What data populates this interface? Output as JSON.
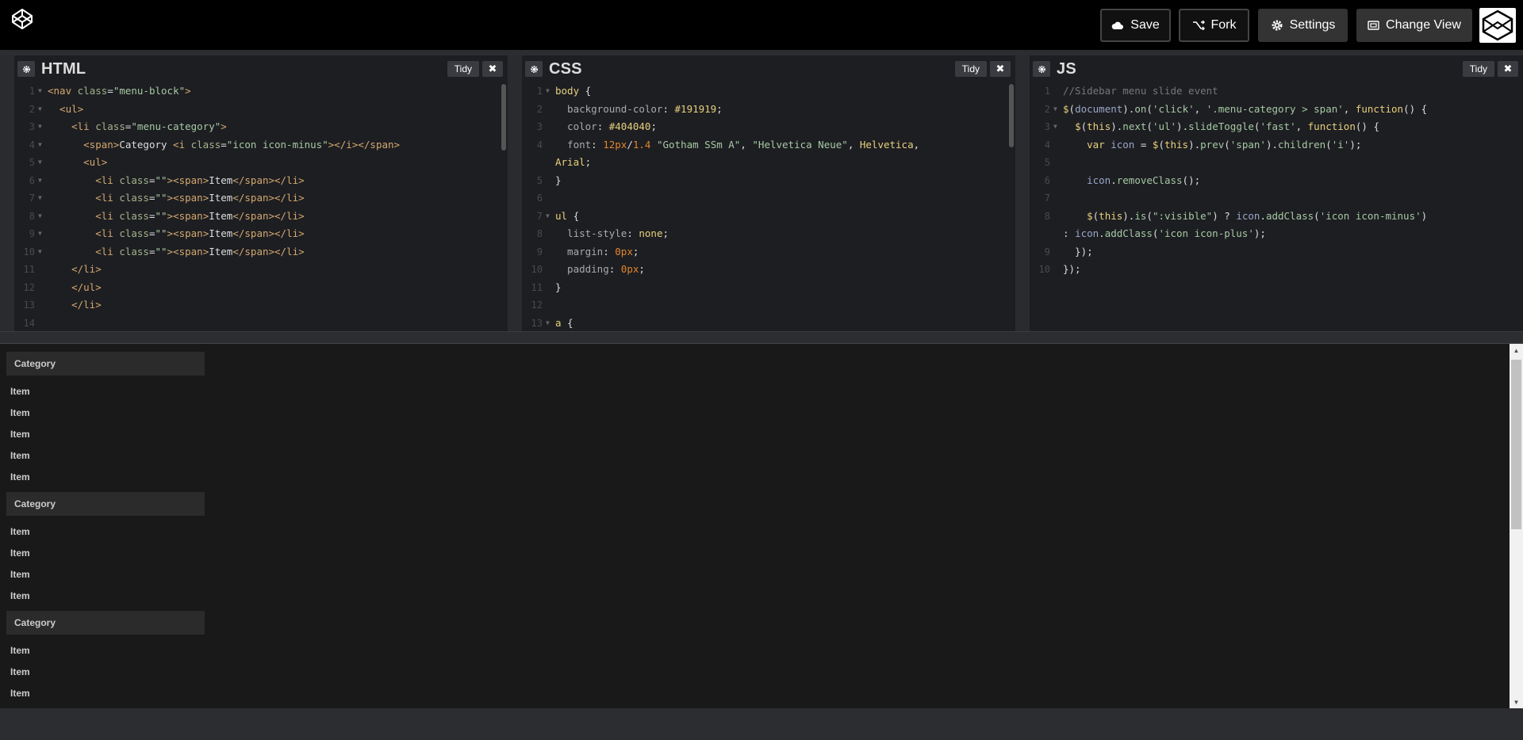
{
  "header": {
    "save_label": "Save",
    "fork_label": "Fork",
    "settings_label": "Settings",
    "change_view_label": "Change View"
  },
  "panes": {
    "html": {
      "title": "HTML",
      "tidy": "Tidy",
      "close": "✖"
    },
    "css": {
      "title": "CSS",
      "tidy": "Tidy",
      "close": "✖"
    },
    "js": {
      "title": "JS",
      "tidy": "Tidy",
      "close": "✖"
    }
  },
  "html_code": [
    {
      "n": "1",
      "f": true,
      "parts": [
        [
          "c-tag",
          "<nav "
        ],
        [
          "c-attr",
          "class"
        ],
        [
          "c-plain",
          "="
        ],
        [
          "c-str",
          "\"menu-block\""
        ],
        [
          "c-tag",
          ">"
        ]
      ]
    },
    {
      "n": "2",
      "f": true,
      "parts": [
        [
          "c-tag",
          "  <ul>"
        ]
      ]
    },
    {
      "n": "3",
      "f": true,
      "parts": [
        [
          "c-tag",
          "    <li "
        ],
        [
          "c-attr",
          "class"
        ],
        [
          "c-plain",
          "="
        ],
        [
          "c-str",
          "\"menu-category\""
        ],
        [
          "c-tag",
          ">"
        ]
      ]
    },
    {
      "n": "4",
      "f": true,
      "parts": [
        [
          "c-tag",
          "      <span>"
        ],
        [
          "c-plain",
          "Category "
        ],
        [
          "c-tag",
          "<i "
        ],
        [
          "c-attr",
          "class"
        ],
        [
          "c-plain",
          "="
        ],
        [
          "c-str",
          "\"icon icon-minus\""
        ],
        [
          "c-tag",
          "></i></span>"
        ]
      ]
    },
    {
      "n": "5",
      "f": true,
      "parts": [
        [
          "c-tag",
          "      <ul>"
        ]
      ]
    },
    {
      "n": "6",
      "f": true,
      "parts": [
        [
          "c-tag",
          "        <li "
        ],
        [
          "c-attr",
          "class"
        ],
        [
          "c-plain",
          "="
        ],
        [
          "c-str",
          "\"\""
        ],
        [
          "c-tag",
          "><span>"
        ],
        [
          "c-plain",
          "Item"
        ],
        [
          "c-tag",
          "</span></li>"
        ]
      ]
    },
    {
      "n": "7",
      "f": true,
      "parts": [
        [
          "c-tag",
          "        <li "
        ],
        [
          "c-attr",
          "class"
        ],
        [
          "c-plain",
          "="
        ],
        [
          "c-str",
          "\"\""
        ],
        [
          "c-tag",
          "><span>"
        ],
        [
          "c-plain",
          "Item"
        ],
        [
          "c-tag",
          "</span></li>"
        ]
      ]
    },
    {
      "n": "8",
      "f": true,
      "parts": [
        [
          "c-tag",
          "        <li "
        ],
        [
          "c-attr",
          "class"
        ],
        [
          "c-plain",
          "="
        ],
        [
          "c-str",
          "\"\""
        ],
        [
          "c-tag",
          "><span>"
        ],
        [
          "c-plain",
          "Item"
        ],
        [
          "c-tag",
          "</span></li>"
        ]
      ]
    },
    {
      "n": "9",
      "f": true,
      "parts": [
        [
          "c-tag",
          "        <li "
        ],
        [
          "c-attr",
          "class"
        ],
        [
          "c-plain",
          "="
        ],
        [
          "c-str",
          "\"\""
        ],
        [
          "c-tag",
          "><span>"
        ],
        [
          "c-plain",
          "Item"
        ],
        [
          "c-tag",
          "</span></li>"
        ]
      ]
    },
    {
      "n": "10",
      "f": true,
      "parts": [
        [
          "c-tag",
          "        <li "
        ],
        [
          "c-attr",
          "class"
        ],
        [
          "c-plain",
          "="
        ],
        [
          "c-str",
          "\"\""
        ],
        [
          "c-tag",
          "><span>"
        ],
        [
          "c-plain",
          "Item"
        ],
        [
          "c-tag",
          "</span></li>"
        ]
      ]
    },
    {
      "n": "11",
      "f": false,
      "parts": [
        [
          "c-tag",
          "    </li>"
        ]
      ]
    },
    {
      "n": "12",
      "f": false,
      "parts": [
        [
          "c-tag",
          "    </ul>"
        ]
      ]
    },
    {
      "n": "13",
      "f": false,
      "parts": [
        [
          "c-tag",
          "    </li>"
        ]
      ]
    },
    {
      "n": "14",
      "f": false,
      "parts": [
        [
          "c-plain",
          ""
        ]
      ]
    }
  ],
  "css_code": [
    {
      "n": "1",
      "f": true,
      "parts": [
        [
          "c-sel",
          "body"
        ],
        [
          "c-plain",
          " {"
        ]
      ]
    },
    {
      "n": "2",
      "f": false,
      "parts": [
        [
          "c-prop",
          "  background-color"
        ],
        [
          "c-plain",
          ": "
        ],
        [
          "c-sel",
          "#191919"
        ],
        [
          "c-plain",
          ";"
        ]
      ]
    },
    {
      "n": "3",
      "f": false,
      "parts": [
        [
          "c-prop",
          "  color"
        ],
        [
          "c-plain",
          ": "
        ],
        [
          "c-sel",
          "#404040"
        ],
        [
          "c-plain",
          ";"
        ]
      ]
    },
    {
      "n": "4",
      "f": false,
      "parts": [
        [
          "c-prop",
          "  font"
        ],
        [
          "c-plain",
          ": "
        ],
        [
          "c-num",
          "12px"
        ],
        [
          "c-plain",
          "/"
        ],
        [
          "c-num",
          "1.4"
        ],
        [
          "c-plain",
          " "
        ],
        [
          "c-str",
          "\"Gotham SSm A\""
        ],
        [
          "c-plain",
          ", "
        ],
        [
          "c-str",
          "\"Helvetica Neue\""
        ],
        [
          "c-plain",
          ", "
        ],
        [
          "c-sel",
          "Helvetica"
        ],
        [
          "c-plain",
          ","
        ]
      ]
    },
    {
      "n": "",
      "f": false,
      "parts": [
        [
          "c-sel",
          "Arial"
        ],
        [
          "c-plain",
          ";"
        ]
      ]
    },
    {
      "n": "5",
      "f": false,
      "parts": [
        [
          "c-plain",
          "}"
        ]
      ]
    },
    {
      "n": "6",
      "f": false,
      "parts": [
        [
          "c-plain",
          ""
        ]
      ]
    },
    {
      "n": "7",
      "f": true,
      "parts": [
        [
          "c-sel",
          "ul"
        ],
        [
          "c-plain",
          " {"
        ]
      ]
    },
    {
      "n": "8",
      "f": false,
      "parts": [
        [
          "c-prop",
          "  list-style"
        ],
        [
          "c-plain",
          ": "
        ],
        [
          "c-sel",
          "none"
        ],
        [
          "c-plain",
          ";"
        ]
      ]
    },
    {
      "n": "9",
      "f": false,
      "parts": [
        [
          "c-prop",
          "  margin"
        ],
        [
          "c-plain",
          ": "
        ],
        [
          "c-num",
          "0px"
        ],
        [
          "c-plain",
          ";"
        ]
      ]
    },
    {
      "n": "10",
      "f": false,
      "parts": [
        [
          "c-prop",
          "  padding"
        ],
        [
          "c-plain",
          ": "
        ],
        [
          "c-num",
          "0px"
        ],
        [
          "c-plain",
          ";"
        ]
      ]
    },
    {
      "n": "11",
      "f": false,
      "parts": [
        [
          "c-plain",
          "}"
        ]
      ]
    },
    {
      "n": "12",
      "f": false,
      "parts": [
        [
          "c-plain",
          ""
        ]
      ]
    },
    {
      "n": "13",
      "f": true,
      "parts": [
        [
          "c-sel",
          "a"
        ],
        [
          "c-plain",
          " {"
        ]
      ]
    }
  ],
  "js_code": [
    {
      "n": "1",
      "f": false,
      "parts": [
        [
          "c-com",
          "//Sidebar menu slide event"
        ]
      ]
    },
    {
      "n": "2",
      "f": true,
      "parts": [
        [
          "c-kw",
          "$"
        ],
        [
          "c-plain",
          "("
        ],
        [
          "c-var",
          "document"
        ],
        [
          "c-plain",
          ")."
        ],
        [
          "c-fn",
          "on"
        ],
        [
          "c-plain",
          "("
        ],
        [
          "c-str",
          "'click'"
        ],
        [
          "c-plain",
          ", "
        ],
        [
          "c-str",
          "'.menu-category > span'"
        ],
        [
          "c-plain",
          ", "
        ],
        [
          "c-kw",
          "function"
        ],
        [
          "c-plain",
          "() {"
        ]
      ]
    },
    {
      "n": "3",
      "f": true,
      "parts": [
        [
          "c-plain",
          "  "
        ],
        [
          "c-kw",
          "$"
        ],
        [
          "c-plain",
          "("
        ],
        [
          "c-kw",
          "this"
        ],
        [
          "c-plain",
          ")."
        ],
        [
          "c-fn",
          "next"
        ],
        [
          "c-plain",
          "("
        ],
        [
          "c-str",
          "'ul'"
        ],
        [
          "c-plain",
          ")."
        ],
        [
          "c-fn",
          "slideToggle"
        ],
        [
          "c-plain",
          "("
        ],
        [
          "c-str",
          "'fast'"
        ],
        [
          "c-plain",
          ", "
        ],
        [
          "c-kw",
          "function"
        ],
        [
          "c-plain",
          "() {"
        ]
      ]
    },
    {
      "n": "4",
      "f": false,
      "parts": [
        [
          "c-plain",
          "    "
        ],
        [
          "c-kw",
          "var"
        ],
        [
          "c-plain",
          " "
        ],
        [
          "c-var",
          "icon"
        ],
        [
          "c-plain",
          " = "
        ],
        [
          "c-kw",
          "$"
        ],
        [
          "c-plain",
          "("
        ],
        [
          "c-kw",
          "this"
        ],
        [
          "c-plain",
          ")."
        ],
        [
          "c-fn",
          "prev"
        ],
        [
          "c-plain",
          "("
        ],
        [
          "c-str",
          "'span'"
        ],
        [
          "c-plain",
          ")."
        ],
        [
          "c-fn",
          "children"
        ],
        [
          "c-plain",
          "("
        ],
        [
          "c-str",
          "'i'"
        ],
        [
          "c-plain",
          ");"
        ]
      ]
    },
    {
      "n": "5",
      "f": false,
      "parts": [
        [
          "c-plain",
          ""
        ]
      ]
    },
    {
      "n": "6",
      "f": false,
      "parts": [
        [
          "c-plain",
          "    "
        ],
        [
          "c-var",
          "icon"
        ],
        [
          "c-plain",
          "."
        ],
        [
          "c-fn",
          "removeClass"
        ],
        [
          "c-plain",
          "();"
        ]
      ]
    },
    {
      "n": "7",
      "f": false,
      "parts": [
        [
          "c-plain",
          ""
        ]
      ]
    },
    {
      "n": "8",
      "f": false,
      "parts": [
        [
          "c-plain",
          "    "
        ],
        [
          "c-kw",
          "$"
        ],
        [
          "c-plain",
          "("
        ],
        [
          "c-kw",
          "this"
        ],
        [
          "c-plain",
          ")."
        ],
        [
          "c-fn",
          "is"
        ],
        [
          "c-plain",
          "("
        ],
        [
          "c-str",
          "\":visible\""
        ],
        [
          "c-plain",
          ") ? "
        ],
        [
          "c-var",
          "icon"
        ],
        [
          "c-plain",
          "."
        ],
        [
          "c-fn",
          "addClass"
        ],
        [
          "c-plain",
          "("
        ],
        [
          "c-str",
          "'icon icon-minus'"
        ],
        [
          "c-plain",
          ")"
        ]
      ]
    },
    {
      "n": "",
      "f": false,
      "parts": [
        [
          "c-plain",
          ": "
        ],
        [
          "c-var",
          "icon"
        ],
        [
          "c-plain",
          "."
        ],
        [
          "c-fn",
          "addClass"
        ],
        [
          "c-plain",
          "("
        ],
        [
          "c-str",
          "'icon icon-plus'"
        ],
        [
          "c-plain",
          ");"
        ]
      ]
    },
    {
      "n": "9",
      "f": false,
      "parts": [
        [
          "c-plain",
          "  });"
        ]
      ]
    },
    {
      "n": "10",
      "f": false,
      "parts": [
        [
          "c-plain",
          "});"
        ]
      ]
    }
  ],
  "preview": {
    "groups": [
      {
        "category": "Category",
        "items": [
          "Item",
          "Item",
          "Item",
          "Item",
          "Item"
        ]
      },
      {
        "category": "Category",
        "items": [
          "Item",
          "Item",
          "Item",
          "Item"
        ]
      },
      {
        "category": "Category",
        "items": [
          "Item",
          "Item",
          "Item"
        ]
      }
    ]
  }
}
